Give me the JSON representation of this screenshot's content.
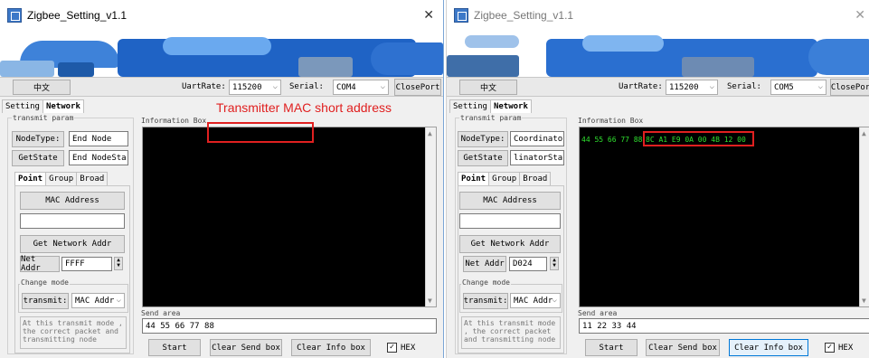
{
  "colors": {
    "accent": "#0078d7",
    "annotation_red": "#e02020",
    "hex_text": "#2fe02f",
    "info_bg": "#000000"
  },
  "annotation": "Transmitter MAC short address",
  "left": {
    "title": "Zigbee_Setting_v1.1",
    "toolbar": {
      "lang_button": "中文",
      "uart_label": "UartRate:",
      "uart_value": "115200",
      "serial_label": "Serial:",
      "serial_value": "COM4",
      "close_port": "ClosePort"
    },
    "main_tabs": [
      "Setting",
      "Network"
    ],
    "transmit_param": "transmit param",
    "node_type_button": "NodeType:",
    "node_type_value": "End Node",
    "get_state_button": "GetState",
    "get_state_value": "End NodeSta",
    "mode_tabs": [
      "Point",
      "Group",
      "Broad"
    ],
    "mac_address_button": "MAC Address",
    "mac_value": "",
    "get_net_addr_button": "Get Network Addr",
    "net_addr_button": "Net Addr",
    "net_addr_value": "FFFF",
    "change_mode": "Change mode",
    "transmit_button": "transmit:",
    "transmit_value": "MAC Addr",
    "hint_text": "At this transmit mode , the correct packet and transmitting node",
    "info_label": "Information Box",
    "info_content": "",
    "send_area_label": "Send area",
    "send_value": "44 55 66 77 88",
    "start_button": "Start",
    "clear_send_button": "Clear Send box",
    "clear_info_button": "Clear Info box",
    "hex_label": "HEX"
  },
  "right": {
    "title": "Zigbee_Setting_v1.1",
    "toolbar": {
      "lang_button": "中文",
      "uart_label": "UartRate:",
      "uart_value": "115200",
      "serial_label": "Serial:",
      "serial_value": "COM5",
      "close_port": "ClosePor"
    },
    "main_tabs": [
      "Setting",
      "Network"
    ],
    "transmit_param": "transmit param",
    "node_type_button": "NodeType:",
    "node_type_value": "Coordinator",
    "get_state_button": "GetState",
    "get_state_value": "linatorStart",
    "mode_tabs": [
      "Point",
      "Group",
      "Broad"
    ],
    "mac_address_button": "MAC Address",
    "mac_value": "",
    "get_net_addr_button": "Get Network Addr",
    "net_addr_button": "Net Addr",
    "net_addr_value": "D024",
    "change_mode": "Change mode",
    "transmit_button": "transmit:",
    "transmit_value": "MAC Addr",
    "hint_text": "At this transmit mode , the correct packet and transmitting node",
    "info_label": "Information Box",
    "info_prefix": "44 55 66 77 88",
    "info_highlight": "8C A1 E9 0A 00 4B 12 00",
    "send_area_label": "Send area",
    "send_value": "11 22 33 44",
    "start_button": "Start",
    "clear_send_button": "Clear Send box",
    "clear_info_button": "Clear Info box",
    "hex_label": "HEX"
  }
}
